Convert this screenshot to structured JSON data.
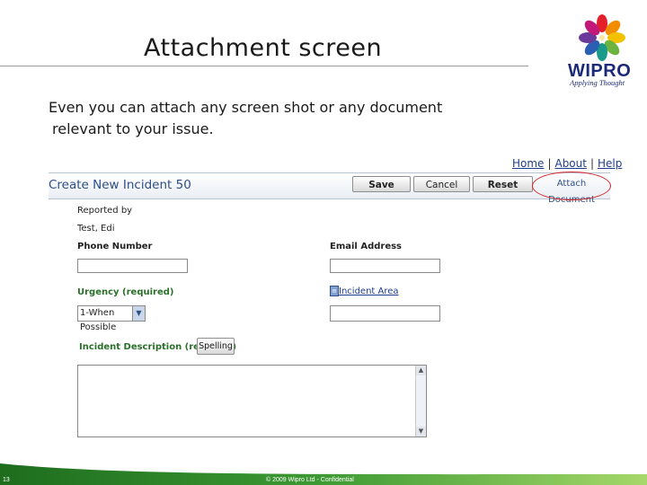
{
  "slide": {
    "title": "Attachment screen",
    "body_lines": [
      "Even you can attach any screen shot or any document",
      "relevant to your issue."
    ],
    "logo": {
      "word": "WIPRO",
      "tagline": "Applying Thought"
    }
  },
  "screenshot": {
    "nav": {
      "home": "Home",
      "about": "About",
      "help": "Help",
      "separator": "|"
    },
    "header_title": "Create New Incident 50",
    "buttons": {
      "save": "Save",
      "cancel": "Cancel",
      "reset": "Reset",
      "attach": "Attach Document",
      "spelling": "Spelling"
    },
    "form": {
      "reported_by_label": "Reported by",
      "reported_by_value": "Test, Edi",
      "phone_label": "Phone Number",
      "phone_value": "",
      "email_label": "Email Address",
      "email_value": "",
      "urgency_label": "Urgency (required)",
      "urgency_selected": "1-When Possible",
      "incident_area_link": "Incident Area",
      "incident_area_value": "",
      "description_label": "Incident Description (required)",
      "description_value": ""
    }
  },
  "footer": {
    "page_number": "13",
    "copyright": "© 2009 Wipro Ltd - Confidential"
  },
  "colors": {
    "brand_blue": "#1b2a78",
    "link_blue": "#1f3d8f",
    "required_green": "#2a6f2a",
    "highlight_red": "#d2242a",
    "footer_green": "#3d9a33"
  }
}
